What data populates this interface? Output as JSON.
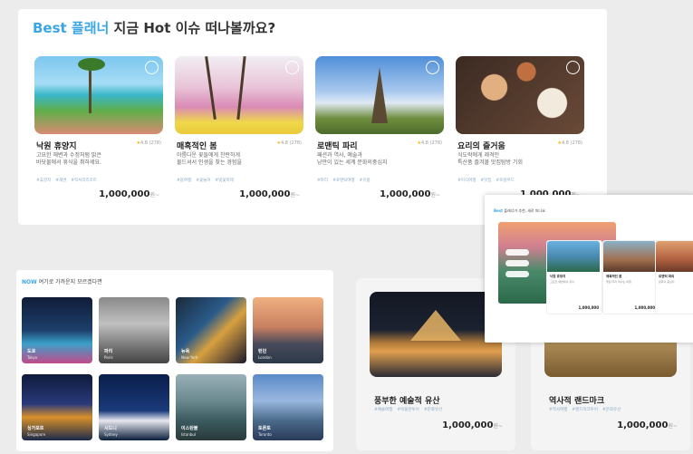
{
  "best": {
    "title_accent": "Best 플래너",
    "title_rest": " 지금 Hot 이슈 떠나볼까요?",
    "cards": [
      {
        "name": "낙원 휴양지",
        "rating": "4.8 (278)",
        "desc": "고요한 해변과 수정처럼 맑은\n바닷물에서 휴식을 취하세요.",
        "tags": [
          "#휴양지",
          "#해변",
          "#럭셔리리조트"
        ],
        "price": "1,000,000",
        "unit": "원~"
      },
      {
        "name": "매혹적인 봄",
        "rating": "4.8 (278)",
        "desc": "아름다운 꽃들에게 찬란하게\n물드셔서 인생을 찾는 경험을",
        "tags": [
          "#봄여행",
          "#꽃놀이",
          "#벚꽃축제"
        ],
        "price": "1,000,000",
        "unit": "원~"
      },
      {
        "name": "로맨틱 파리",
        "rating": "4.8 (278)",
        "desc": "패션과 역사, 예술과\n낭만이 있는 세계 문화의중심지",
        "tags": [
          "#파리",
          "#로맨틱여행",
          "#유럽"
        ],
        "price": "1,000,000",
        "unit": "원~"
      },
      {
        "name": "요리의 즐거움",
        "rating": "4.8 (278)",
        "desc": "식도락에게 제격인\n특산품 즐겨볼 맛집탐방 기회",
        "tags": [
          "#미식여행",
          "#맛집",
          "#로컬푸드"
        ],
        "price": "1,000,000",
        "unit": "원~"
      }
    ]
  },
  "now": {
    "title_accent": "NOW",
    "title_rest": " 여기로 가까운지 모르겠다면",
    "tiles": [
      {
        "label": "도쿄",
        "sub": "Tokyo"
      },
      {
        "label": "파리",
        "sub": "Paris"
      },
      {
        "label": "뉴욕",
        "sub": "New York"
      },
      {
        "label": "런던",
        "sub": "London"
      },
      {
        "label": "싱가포르",
        "sub": "Singapore"
      },
      {
        "label": "시드니",
        "sub": "Sydney"
      },
      {
        "label": "이스탄불",
        "sub": "Istanbul"
      },
      {
        "label": "토론토",
        "sub": "Toronto"
      }
    ]
  },
  "culture": [
    {
      "title": "풍부한 예술적 유산",
      "tags": [
        "#예술여행",
        "#박물관투어",
        "#문화유산"
      ],
      "price": "1,000,000",
      "unit": "원~"
    },
    {
      "title": "역사적 랜드마크",
      "tags": [
        "#역사여행",
        "#랜드마크투어",
        "#문화유산"
      ],
      "price": "1,000,000",
      "unit": "원~"
    }
  ],
  "overlay": {
    "title_accent": "Best",
    "title_rest": " 플래너가 추천, 새로 떠나요",
    "cards": [
      {
        "name": "낙원 휴양지",
        "desc": "고요한 해변에서 휴식",
        "price": "1,000,000"
      },
      {
        "name": "매혹적인 봄",
        "desc": "꽃길 따라 떠나는 여행",
        "price": "1,000,000"
      },
      {
        "name": "로맨틱 파리",
        "desc": "문화의 중심지",
        "price": "1,000,000"
      }
    ]
  }
}
